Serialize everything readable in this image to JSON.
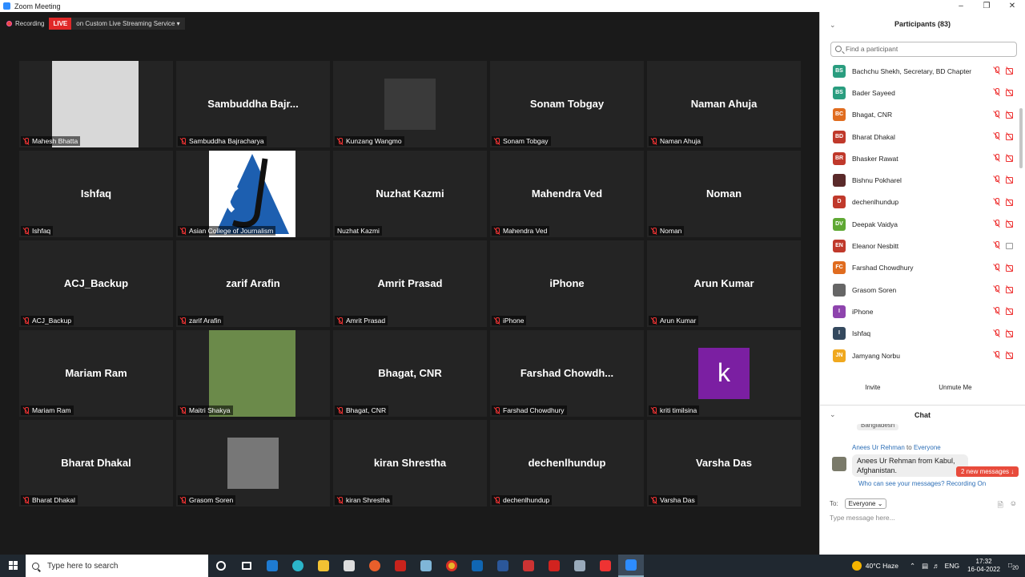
{
  "window": {
    "title": "Zoom Meeting"
  },
  "recording": {
    "label": "Recording",
    "live": "LIVE",
    "stream": "on Custom Live Streaming Service"
  },
  "tiles": [
    {
      "big": "",
      "label": "Mahesh Bhatta",
      "muted": true,
      "photo": "person-photo"
    },
    {
      "big": "Sambuddha  Bajr...",
      "label": "Sambuddha Bajracharya",
      "muted": true
    },
    {
      "big": "",
      "label": "Kunzang Wangmo",
      "muted": true,
      "photo": "person-photo"
    },
    {
      "big": "Sonam Tobgay",
      "label": "Sonam Tobgay",
      "muted": true
    },
    {
      "big": "Naman Ahuja",
      "label": "Naman Ahuja",
      "muted": true
    },
    {
      "big": "Ishfaq",
      "label": "Ishfaq",
      "muted": true
    },
    {
      "big": "",
      "label": "Asian College of Journalism",
      "muted": true,
      "photo": "logo"
    },
    {
      "big": "Nuzhat Kazmi",
      "label": "Nuzhat Kazmi",
      "muted": false
    },
    {
      "big": "Mahendra Ved",
      "label": "Mahendra Ved",
      "muted": true
    },
    {
      "big": "Noman",
      "label": "Noman",
      "muted": true
    },
    {
      "big": "ACJ_Backup",
      "label": "ACJ_Backup",
      "muted": true
    },
    {
      "big": "zarif Arafin",
      "label": "zarif Arafin",
      "muted": true
    },
    {
      "big": "Amrit Prasad",
      "label": "Amrit Prasad",
      "muted": true
    },
    {
      "big": "iPhone",
      "label": "iPhone",
      "muted": true
    },
    {
      "big": "Arun Kumar",
      "label": "Arun Kumar",
      "muted": true
    },
    {
      "big": "Mariam Ram",
      "label": "Mariam Ram",
      "muted": true
    },
    {
      "big": "",
      "label": "Maitri Shakya",
      "muted": true,
      "photo": "person-photo"
    },
    {
      "big": "Bhagat, CNR",
      "label": "Bhagat, CNR",
      "muted": true
    },
    {
      "big": "Farshad  Chowdh...",
      "label": "Farshad Chowdhury",
      "muted": true
    },
    {
      "big": "",
      "label": "kriti timilsina",
      "muted": true,
      "photo": "letter",
      "letter": "k"
    },
    {
      "big": "Bharat Dhakal",
      "label": "Bharat Dhakal",
      "muted": true
    },
    {
      "big": "",
      "label": "Grasom Soren",
      "muted": true,
      "photo": "person-photo"
    },
    {
      "big": "kiran Shrestha",
      "label": "kiran Shrestha",
      "muted": true
    },
    {
      "big": "dechenlhundup",
      "label": "dechenlhundup",
      "muted": true
    },
    {
      "big": "Varsha Das",
      "label": "Varsha Das",
      "muted": true
    }
  ],
  "participants": {
    "title": "Participants (83)",
    "search_placeholder": "Find a participant",
    "list": [
      {
        "initials": "BS",
        "name": "Bachchu Shekh, Secretary, BD Chapter",
        "color": "#2a9d7f",
        "video_off_red": true
      },
      {
        "initials": "BS",
        "name": "Bader Sayeed",
        "color": "#2a9d7f",
        "video_off_red": true
      },
      {
        "initials": "BC",
        "name": "Bhagat, CNR",
        "color": "#e06c1f",
        "video_off_red": true
      },
      {
        "initials": "BD",
        "name": "Bharat Dhakal",
        "color": "#c0392b",
        "video_off_red": true
      },
      {
        "initials": "BR",
        "name": "Bhasker Rawat",
        "color": "#c0392b",
        "video_off_red": true
      },
      {
        "initials": "",
        "name": "Bishnu Pokharel",
        "color": "#5a2a2a",
        "video_off_red": true
      },
      {
        "initials": "D",
        "name": "dechenlhundup",
        "color": "#c0392b",
        "video_off_red": true
      },
      {
        "initials": "DV",
        "name": "Deepak Vaidya",
        "color": "#5fa833",
        "video_off_red": true
      },
      {
        "initials": "EN",
        "name": "Eleanor Nesbitt",
        "color": "#c0392b",
        "video_off_red": false
      },
      {
        "initials": "FC",
        "name": "Farshad Chowdhury",
        "color": "#e06c1f",
        "video_off_red": true
      },
      {
        "initials": "",
        "name": "Grasom Soren",
        "color": "#666666",
        "video_off_red": true
      },
      {
        "initials": "I",
        "name": "iPhone",
        "color": "#8e44ad",
        "video_off_red": true
      },
      {
        "initials": "I",
        "name": "Ishfaq",
        "color": "#34495e",
        "video_off_red": true
      },
      {
        "initials": "JN",
        "name": "Jamyang Norbu",
        "color": "#f0a81e",
        "video_off_red": true
      }
    ],
    "invite": "Invite",
    "unmute": "Unmute Me"
  },
  "chat": {
    "title": "Chat",
    "prev_snippet": "Bangladesh",
    "from": "Anees Ur Rehman",
    "to_word": "to",
    "to": "Everyone",
    "message": "Anees Ur Rehman from Kabul, Afghanistan.",
    "new_messages": "2 new messages",
    "who_can_see": "Who can see your messages? Recording On",
    "to_label": "To:",
    "recipient": "Everyone",
    "placeholder": "Type message here..."
  },
  "taskbar": {
    "search_placeholder": "Type here to search",
    "weather": "40°C  Haze",
    "lang": "ENG",
    "time": "17:32",
    "date": "16-04-2022",
    "notif": "20"
  }
}
